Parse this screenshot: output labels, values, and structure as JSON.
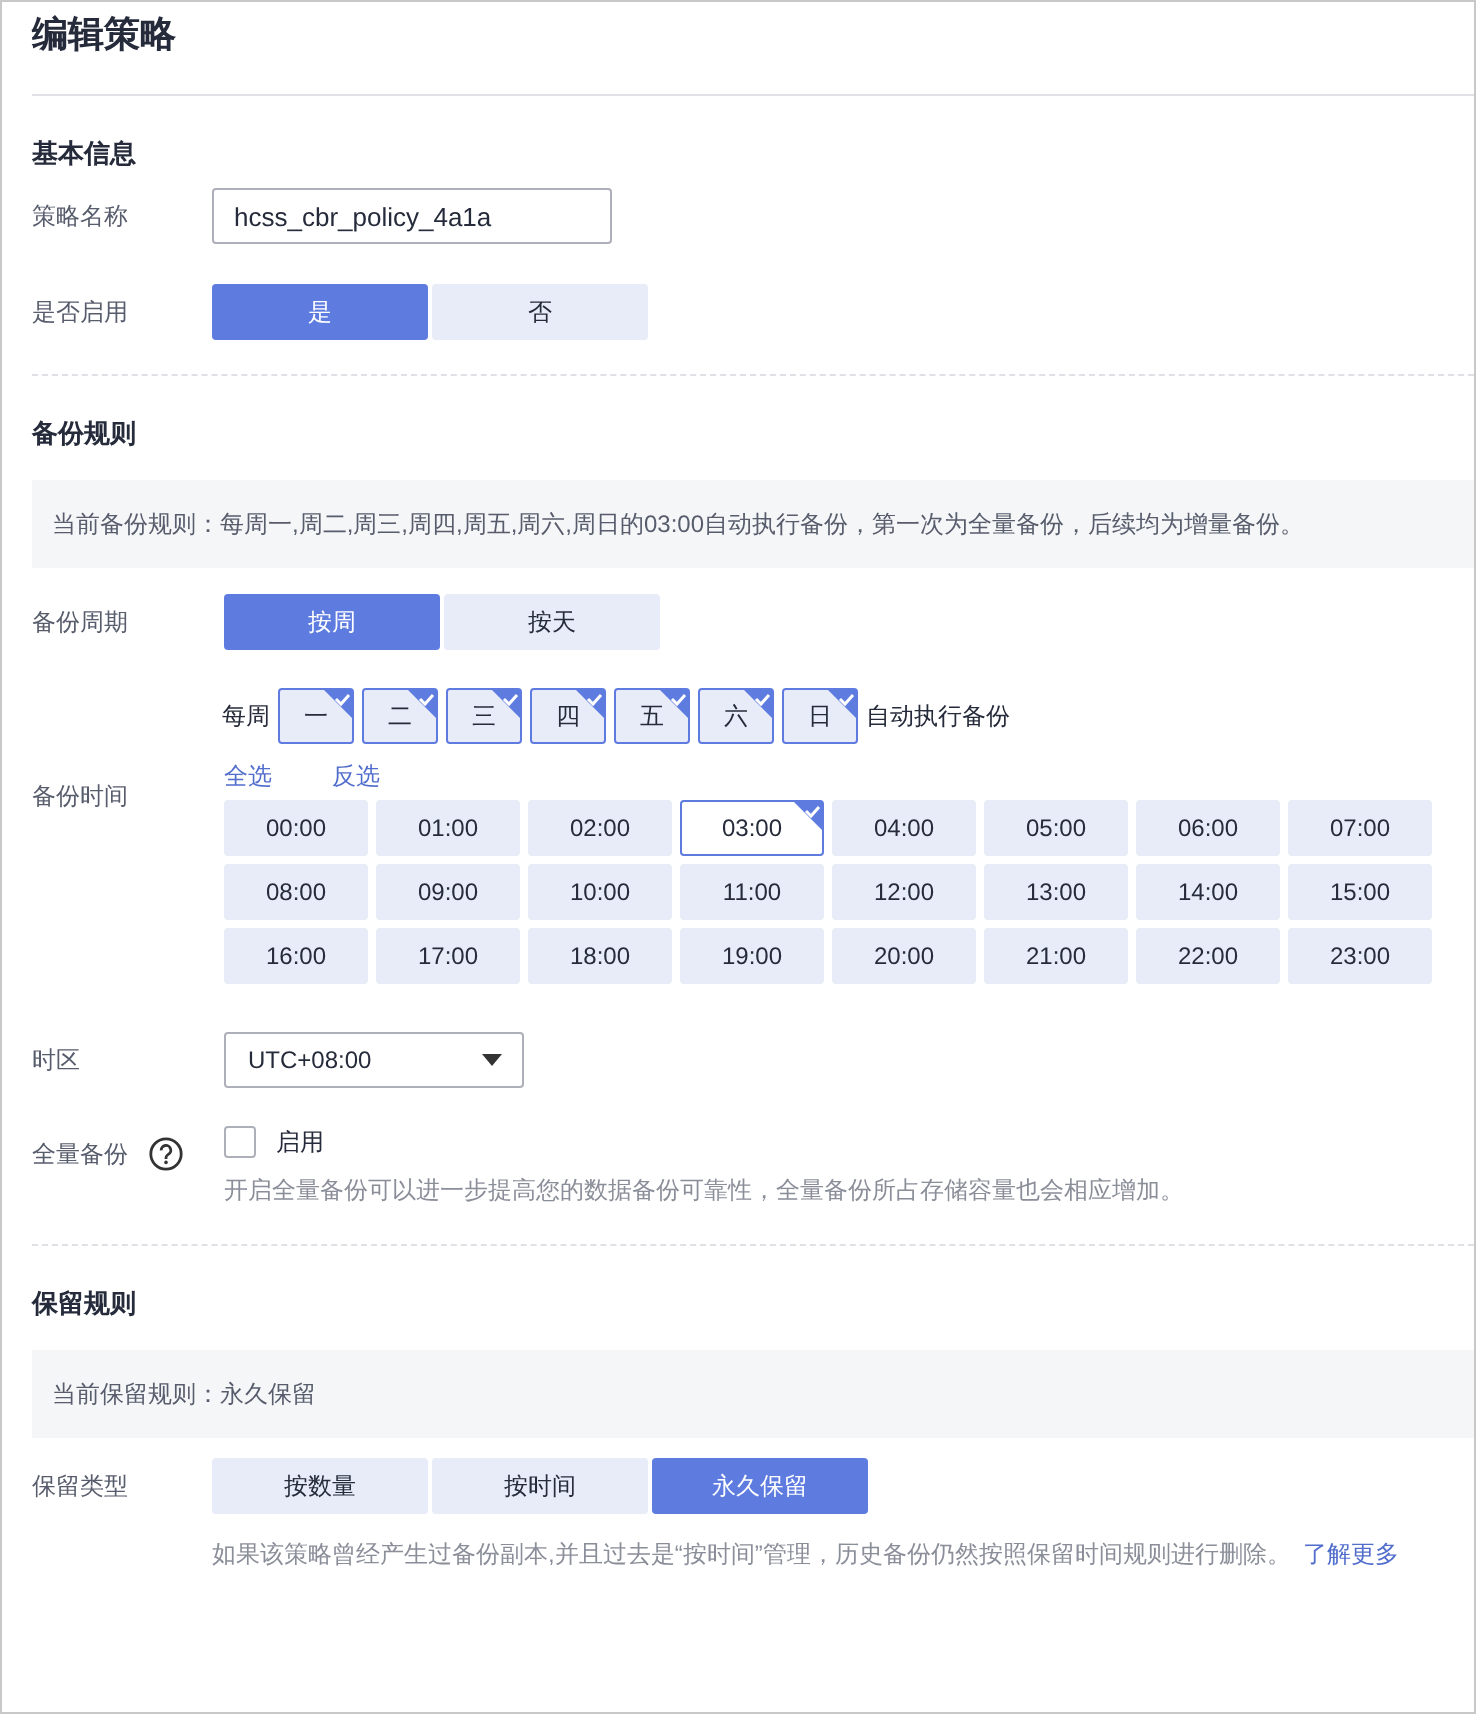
{
  "title": "编辑策略",
  "basic": {
    "heading": "基本信息",
    "name_label": "策略名称",
    "name_value": "hcss_cbr_policy_4a1a",
    "enable_label": "是否启用",
    "enable_options": [
      {
        "label": "是",
        "selected": true
      },
      {
        "label": "否",
        "selected": false
      }
    ]
  },
  "backup": {
    "heading": "备份规则",
    "summary": "当前备份规则：每周一,周二,周三,周四,周五,周六,周日的03:00自动执行备份，第一次为全量备份，后续均为增量备份。",
    "cycle_label": "备份周期",
    "cycle_options": [
      {
        "label": "按周",
        "selected": true
      },
      {
        "label": "按天",
        "selected": false
      }
    ],
    "week_prefix": "每周",
    "days": [
      {
        "label": "一",
        "checked": true
      },
      {
        "label": "二",
        "checked": true
      },
      {
        "label": "三",
        "checked": true
      },
      {
        "label": "四",
        "checked": true
      },
      {
        "label": "五",
        "checked": true
      },
      {
        "label": "六",
        "checked": true
      },
      {
        "label": "日",
        "checked": true
      }
    ],
    "week_suffix": "自动执行备份",
    "time_label": "备份时间",
    "select_all": "全选",
    "invert": "反选",
    "times": [
      {
        "label": "00:00",
        "selected": false
      },
      {
        "label": "01:00",
        "selected": false
      },
      {
        "label": "02:00",
        "selected": false
      },
      {
        "label": "03:00",
        "selected": true
      },
      {
        "label": "04:00",
        "selected": false
      },
      {
        "label": "05:00",
        "selected": false
      },
      {
        "label": "06:00",
        "selected": false
      },
      {
        "label": "07:00",
        "selected": false
      },
      {
        "label": "08:00",
        "selected": false
      },
      {
        "label": "09:00",
        "selected": false
      },
      {
        "label": "10:00",
        "selected": false
      },
      {
        "label": "11:00",
        "selected": false
      },
      {
        "label": "12:00",
        "selected": false
      },
      {
        "label": "13:00",
        "selected": false
      },
      {
        "label": "14:00",
        "selected": false
      },
      {
        "label": "15:00",
        "selected": false
      },
      {
        "label": "16:00",
        "selected": false
      },
      {
        "label": "17:00",
        "selected": false
      },
      {
        "label": "18:00",
        "selected": false
      },
      {
        "label": "19:00",
        "selected": false
      },
      {
        "label": "20:00",
        "selected": false
      },
      {
        "label": "21:00",
        "selected": false
      },
      {
        "label": "22:00",
        "selected": false
      },
      {
        "label": "23:00",
        "selected": false
      }
    ],
    "timezone_label": "时区",
    "timezone": "UTC+08:00",
    "full_label": "全量备份",
    "full_checkbox": {
      "label": "启用",
      "checked": false
    },
    "full_hint": "开启全量备份可以进一步提高您的数据备份可靠性，全量备份所占存储容量也会相应增加。"
  },
  "retention": {
    "heading": "保留规则",
    "summary": "当前保留规则：永久保留",
    "type_label": "保留类型",
    "type_options": [
      {
        "label": "按数量",
        "selected": false
      },
      {
        "label": "按时间",
        "selected": false
      },
      {
        "label": "永久保留",
        "selected": true
      }
    ],
    "hint": "如果该策略曾经产生过备份副本,并且过去是“按时间”管理，历史备份仍然按照保留时间规则进行删除。",
    "link": "了解更多"
  }
}
